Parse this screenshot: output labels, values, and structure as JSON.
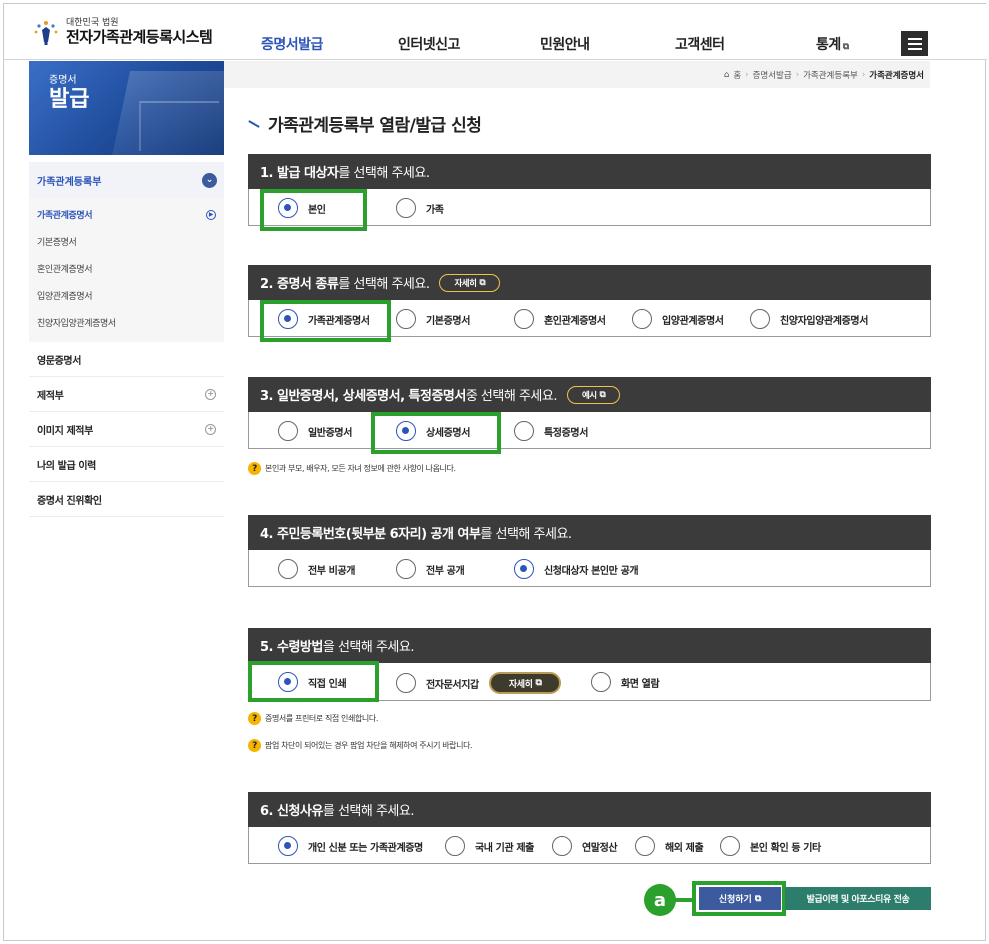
{
  "header": {
    "logo_court": "대한민국 법원",
    "logo_title": "전자가족관계등록시스템",
    "nav": [
      "증명서발급",
      "인터넷신고",
      "민원안내",
      "고객센터",
      "통계"
    ],
    "nav_ext_icon": "external-link-icon"
  },
  "sidebar": {
    "banner_small": "증명서",
    "banner_big": "발급",
    "group_title": "가족관계등록부",
    "sub_items": [
      "가족관계증명서",
      "기본증명서",
      "혼인관계증명서",
      "입양관계증명서",
      "친양자입양관계증명서"
    ],
    "rows": [
      "영문증명서",
      "제적부",
      "이미지 제적부",
      "나의 발급 이력",
      "증명서 진위확인"
    ]
  },
  "breadcrumb": [
    "홈",
    "증명서발급",
    "가족관계등록부",
    "가족관계증명서"
  ],
  "page_title": "가족관계등록부 열람/발급 신청",
  "sections": {
    "s1": {
      "title_bold": "1. 발급 대상자",
      "title_rest": "를 선택해 주세요.",
      "options": [
        "본인",
        "가족"
      ],
      "selected": "본인"
    },
    "s2": {
      "title_bold": "2. 증명서 종류",
      "title_rest": "를 선택해 주세요.",
      "pill": "자세히",
      "options": [
        "가족관계증명서",
        "기본증명서",
        "혼인관계증명서",
        "입양관계증명서",
        "친양자입양관계증명서"
      ],
      "selected": "가족관계증명서"
    },
    "s3": {
      "title_bold": "3. 일반증명서, 상세증명서, 특정증명서",
      "title_rest": " 중 선택해 주세요.",
      "pill": "예시",
      "options": [
        "일반증명서",
        "상세증명서",
        "특정증명서"
      ],
      "selected": "상세증명서",
      "note": "본인과 부모, 배우자, 모든 자녀 정보에 관한 사항이 나옵니다."
    },
    "s4": {
      "title_bold": "4. 주민등록번호(뒷부분 6자리) 공개 여부",
      "title_rest": "를 선택해 주세요.",
      "options": [
        "전부 비공개",
        "전부 공개",
        "신청대상자 본인만 공개"
      ],
      "selected": "신청대상자 본인만 공개"
    },
    "s5": {
      "title_bold": "5. 수령방법",
      "title_rest": "을 선택해 주세요.",
      "options": [
        "직접 인쇄",
        "전자문서지갑",
        "화면 열람"
      ],
      "inline_pill": "자세히",
      "selected": "직접 인쇄",
      "notes": [
        "증명서를 프린터로 직접 인쇄합니다.",
        "팝업 차단이 되어있는 경우 팝업 차단을 해제하여 주시기 바랍니다."
      ]
    },
    "s6": {
      "title_bold": "6. 신청사유",
      "title_rest": "를 선택해 주세요.",
      "options": [
        "개인 신분 또는 가족관계증명",
        "국내 기관 제출",
        "연말정산",
        "해외 제출",
        "본인 확인 등 기타"
      ],
      "selected": "개인 신분 또는 가족관계증명"
    }
  },
  "buttons": {
    "apply": "신청하기",
    "history": "발급이력 및 아포스티유 전송"
  },
  "annotation_badge": "a",
  "colors": {
    "accent": "#2d55b8",
    "highlight": "#2ca02c",
    "section_header": "#3b3b3b",
    "history_button": "#2d7d6d"
  }
}
